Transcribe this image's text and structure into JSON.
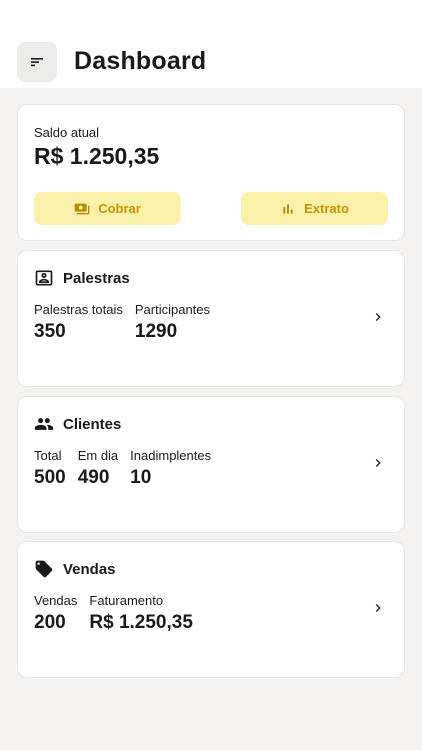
{
  "header": {
    "title": "Dashboard",
    "menu_icon": "sort-menu-icon"
  },
  "balance": {
    "label": "Saldo atual",
    "value": "R$ 1.250,35",
    "buttons": [
      {
        "label": "Cobrar",
        "icon": "cash-icon"
      },
      {
        "label": "Extrato",
        "icon": "bar-chart-icon"
      }
    ]
  },
  "sections": {
    "palestras": {
      "title": "Palestras",
      "icon": "contact-card-icon",
      "stats": [
        {
          "label": "Palestras totais",
          "value": "350"
        },
        {
          "label": "Participantes",
          "value": "1290"
        }
      ]
    },
    "clientes": {
      "title": "Clientes",
      "icon": "people-icon",
      "stats": [
        {
          "label": "Total",
          "value": "500"
        },
        {
          "label": "Em dia",
          "value": "490"
        },
        {
          "label": "Inadimplentes",
          "value": "10"
        }
      ]
    },
    "vendas": {
      "title": "Vendas",
      "icon": "tag-icon",
      "stats": [
        {
          "label": "Vendas",
          "value": "200"
        },
        {
          "label": "Faturamento",
          "value": "R$ 1.250,35"
        }
      ]
    }
  },
  "colors": {
    "accent_bg": "#fbf0a9",
    "accent_text": "#c69300",
    "page_bg": "#f4f3f1"
  }
}
